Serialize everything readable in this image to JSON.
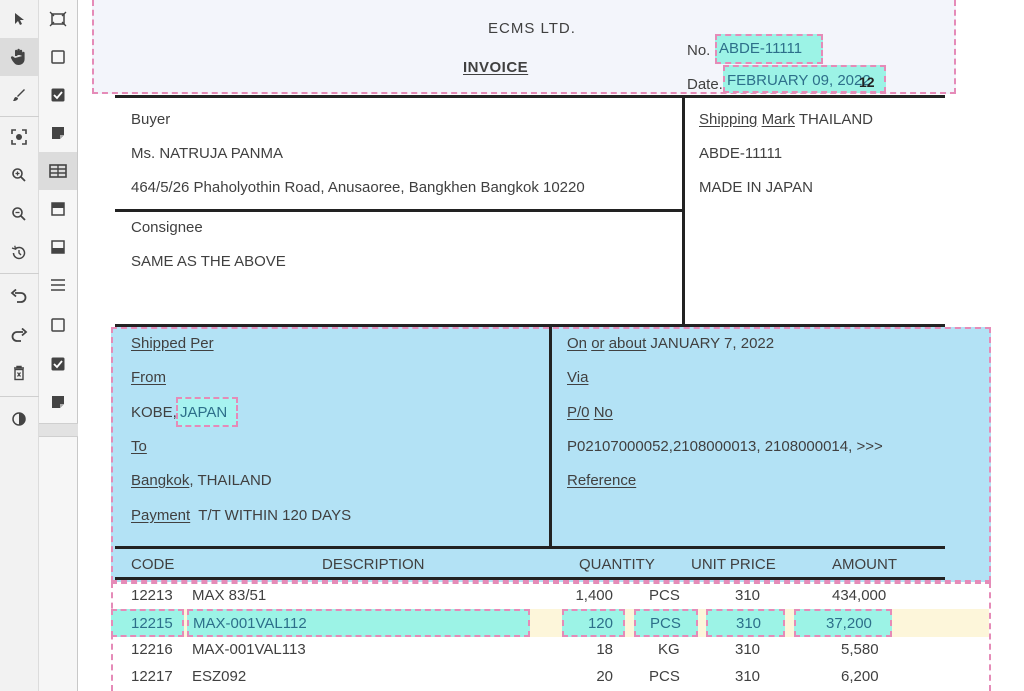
{
  "header": {
    "company": "ECMS LTD.",
    "doc_type": "INVOICE",
    "no_label": "No.",
    "no_value": "ABDE-11111",
    "date_label": "Date.",
    "date_value": "FEBRUARY 09, 2022",
    "marker": "12"
  },
  "buyer": {
    "label": "Buyer",
    "name": "Ms. NATRUJA PANMA",
    "address": "464/5/26 Phaholyothin Road, Anusaoree, Bangkhen Bangkok 10220"
  },
  "consignee": {
    "label": "Consignee",
    "value": "SAME AS THE ABOVE"
  },
  "shipping_mark": {
    "label_a": "Shipping",
    "label_b": "Mark",
    "value": "THAILAND",
    "line2": "ABDE-11111",
    "line3": "MADE IN JAPAN"
  },
  "shipment": {
    "shipped_a": "Shipped",
    "shipped_b": "Per",
    "from_label": "From",
    "from_city": "KOBE,",
    "from_country": "JAPAN",
    "to_label": "To",
    "to_city": "Bangkok",
    "to_country": ", THAILAND",
    "payment_label": "Payment",
    "payment_value": "T/T WITHIN 120 DAYS",
    "on_a": "On",
    "on_b": "or",
    "on_c": "about",
    "on_value": "JANUARY 7, 2022",
    "via_label": "Via",
    "po_a": "P/0",
    "po_b": "No",
    "po_value": "P02107000052,2108000013, 2108000014, >>>",
    "reference_label": "Reference"
  },
  "table": {
    "headers": {
      "code": "CODE",
      "description": "DESCRIPTION",
      "quantity": "QUANTITY",
      "unit_price": "UNIT PRICE",
      "amount": "AMOUNT"
    },
    "rows": [
      {
        "code": "12213",
        "description": "MAX 83/51",
        "qty": "1,400",
        "unit": "PCS",
        "price": "310",
        "amount": "434,000"
      },
      {
        "code": "12215",
        "description": "MAX-001VAL112",
        "qty": "120",
        "unit": "PCS",
        "price": "310",
        "amount": "37,200"
      },
      {
        "code": "12216",
        "description": "MAX-001VAL113",
        "qty": "18",
        "unit": "KG",
        "price": "310",
        "amount": "5,580"
      },
      {
        "code": "12217",
        "description": "ESZ092",
        "qty": "20",
        "unit": "PCS",
        "price": "310",
        "amount": "6,200"
      }
    ]
  },
  "tools_left": [
    "select-icon",
    "pan-hand-icon",
    "brush-icon",
    "snapshot-icon",
    "zoom-in-icon",
    "zoom-out-icon",
    "history-icon",
    "undo-icon",
    "redo-icon",
    "delete-icon",
    "contrast-icon"
  ],
  "tools_right": [
    "crop-icon",
    "checkbox-empty-icon",
    "checkbox-checked-icon",
    "sticky-note-icon",
    "table-icon",
    "header-block-icon",
    "footer-block-icon",
    "list-icon",
    "checkbox-empty-icon",
    "checkbox-checked-icon",
    "sticky-note-icon"
  ],
  "colors": {
    "zone_border": "#e58bb8",
    "shipment_fill": "#b3e2f5",
    "field_fill": "#9cf3e6",
    "row_highlight": "#fdf6da"
  }
}
